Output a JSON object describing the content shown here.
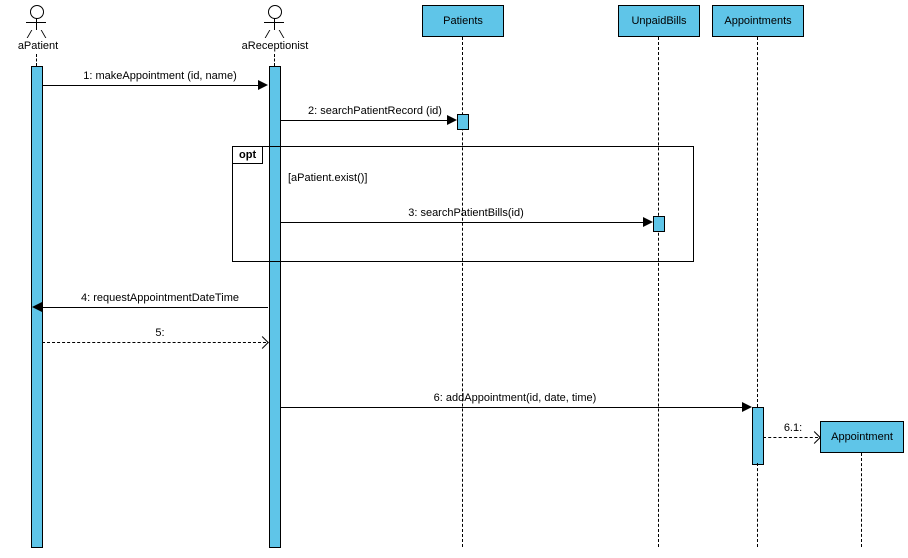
{
  "actors": {
    "aPatient": "aPatient",
    "aReceptionist": "aReceptionist"
  },
  "objects": {
    "patients": "Patients",
    "unpaidBills": "UnpaidBills",
    "appointments": "Appointments",
    "appointment": "Appointment"
  },
  "messages": {
    "m1": "1: makeAppointment (id, name)",
    "m2": "2: searchPatientRecord (id)",
    "m3": "3: searchPatientBills(id)",
    "m4": "4: requestAppointmentDateTime",
    "m5": "5:",
    "m6": "6: addAppointment(id, date, time)",
    "m61": "6.1:"
  },
  "fragment": {
    "type": "opt",
    "guard": "[aPatient.exist()]"
  },
  "chart_data": {
    "type": "sequence_diagram",
    "participants": [
      {
        "name": "aPatient",
        "kind": "actor"
      },
      {
        "name": "aReceptionist",
        "kind": "actor"
      },
      {
        "name": "Patients",
        "kind": "object"
      },
      {
        "name": "UnpaidBills",
        "kind": "object"
      },
      {
        "name": "Appointments",
        "kind": "object"
      },
      {
        "name": "Appointment",
        "kind": "object",
        "created": true
      }
    ],
    "messages": [
      {
        "seq": "1",
        "from": "aPatient",
        "to": "aReceptionist",
        "label": "makeAppointment (id, name)",
        "type": "sync"
      },
      {
        "seq": "2",
        "from": "aReceptionist",
        "to": "Patients",
        "label": "searchPatientRecord (id)",
        "type": "sync"
      },
      {
        "seq": "3",
        "from": "aReceptionist",
        "to": "UnpaidBills",
        "label": "searchPatientBills(id)",
        "type": "sync",
        "fragment": "opt",
        "guard": "aPatient.exist()"
      },
      {
        "seq": "4",
        "from": "aReceptionist",
        "to": "aPatient",
        "label": "requestAppointmentDateTime",
        "type": "sync"
      },
      {
        "seq": "5",
        "from": "aPatient",
        "to": "aReceptionist",
        "label": "",
        "type": "return"
      },
      {
        "seq": "6",
        "from": "aReceptionist",
        "to": "Appointments",
        "label": "addAppointment(id, date, time)",
        "type": "sync"
      },
      {
        "seq": "6.1",
        "from": "Appointments",
        "to": "Appointment",
        "label": "",
        "type": "create"
      }
    ],
    "fragments": [
      {
        "type": "opt",
        "guard": "[aPatient.exist()]",
        "covers": [
          "3"
        ]
      }
    ]
  }
}
